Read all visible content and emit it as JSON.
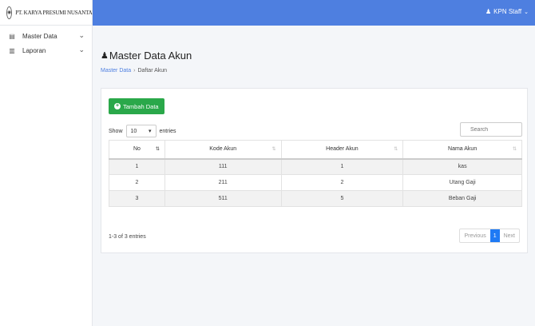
{
  "brand": {
    "logo_text": "◉",
    "name": "PT. KARYA PRESUMI NUSANTARA"
  },
  "header": {
    "user_name": "KPN Staff"
  },
  "sidebar": {
    "items": [
      {
        "label": "Master Data",
        "icon": "database-icon"
      },
      {
        "label": "Laporan",
        "icon": "book-icon"
      }
    ]
  },
  "page": {
    "title": "Master Data Akun",
    "breadcrumb": {
      "link": "Master Data",
      "current": "Daftar Akun"
    }
  },
  "card": {
    "add_button": "Tambah Data",
    "show_label": "Show",
    "entries_value": "10",
    "entries_label": "entries",
    "search_placeholder": "Search",
    "columns": [
      "No",
      "Kode Akun",
      "Header Akun",
      "Nama Akun"
    ],
    "rows": [
      {
        "no": "1",
        "kode": "111",
        "header": "1",
        "nama": "kas"
      },
      {
        "no": "2",
        "kode": "211",
        "header": "2",
        "nama": "Utang Gaji"
      },
      {
        "no": "3",
        "kode": "511",
        "header": "5",
        "nama": "Beban Gaji"
      }
    ],
    "info": "1-3 of 3 entries",
    "pager": {
      "previous": "Previous",
      "page": "1",
      "next": "Next"
    }
  },
  "colors": {
    "topbar": "#4e7fe0",
    "add_button": "#2aa84a",
    "active_page": "#1f7af4"
  }
}
